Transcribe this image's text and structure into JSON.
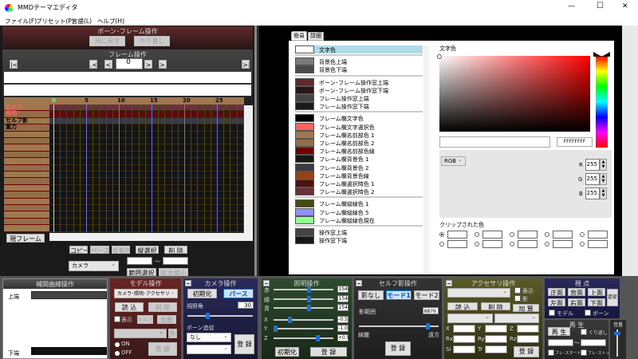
{
  "window": {
    "title": "MMDテーマエディタ",
    "min": "—",
    "max": "☐",
    "close": "✕"
  },
  "menu": [
    "ファイル(F)",
    "プリセット(P)",
    "言語(L)",
    "ヘルプ(H)"
  ],
  "bone_panel": {
    "title": "ボーン･フレーム操作",
    "undo": "元に戻す",
    "redo": "やり直し"
  },
  "frame_panel": {
    "title": "フレーム操作",
    "first": "|<",
    "prev_key": ".<",
    "prev": "<",
    "frame": "0",
    "next": ">",
    "next_key": ">.",
    "last": ">|"
  },
  "timeline": {
    "ticks": [
      "0",
      "5",
      "10",
      "15",
      "20",
      "25"
    ],
    "rows": [
      "カメラ",
      "照明",
      "セルフ影",
      "重力",
      "",
      "",
      "",
      "",
      "",
      "",
      "",
      "",
      "",
      "",
      "",
      "",
      "",
      "",
      ""
    ],
    "current_frame_btn": "現フレーム"
  },
  "edit": {
    "copy": "コピー",
    "paste": "ペースト",
    "flip": "反転P",
    "vsel": "縦選択",
    "del": "削 除",
    "target": "カメラ",
    "tilde": "〜",
    "range": "範囲選択",
    "scale": "拡大縮小"
  },
  "tabs": [
    "簡易",
    "詳細"
  ],
  "color_groups": [
    [
      {
        "label": "文字色",
        "color": "#ffffff"
      }
    ],
    [
      {
        "label": "背景色上端",
        "color": "#7a7a7a"
      },
      {
        "label": "背景色下端",
        "color": "#4a4a4a"
      }
    ],
    [
      {
        "label": "ボーン･フレーム操作窓上端",
        "color": "#5e2a2a"
      },
      {
        "label": "ボーン･フレーム操作窓下端",
        "color": "#2a1616"
      },
      {
        "label": "フレーム操作窓上端",
        "color": "#444444"
      },
      {
        "label": "フレーム操作窓下端",
        "color": "#1a1a1a"
      }
    ],
    [
      {
        "label": "フレーム欄文字色",
        "color": "#000000"
      },
      {
        "label": "フレーム欄文字選択色",
        "color": "#ff6060"
      },
      {
        "label": "フレーム欄名前部色 1",
        "color": "#a07850"
      },
      {
        "label": "フレーム欄名前部色 2",
        "color": "#946c48"
      },
      {
        "label": "フレーム欄名前部色線",
        "color": "#700000"
      },
      {
        "label": "フレーム欄背景色 1",
        "color": "#181818"
      },
      {
        "label": "フレーム欄背景色 2",
        "color": "#3a3a40"
      },
      {
        "label": "フレーム欄背景色線",
        "color": "#a04010"
      },
      {
        "label": "フレーム欄選択時色 1",
        "color": "#501010"
      },
      {
        "label": "フレーム欄選択時色 2",
        "color": "#6a3038"
      }
    ],
    [
      {
        "label": "フレーム欄縦線色 1",
        "color": "#4a4a10"
      },
      {
        "label": "フレーム欄縦線色 5",
        "color": "#9090ff"
      },
      {
        "label": "フレーム欄縦線色現在",
        "color": "#90ff90"
      }
    ],
    [
      {
        "label": "操作窓上端",
        "color": "#444444"
      },
      {
        "label": "操作窓下端",
        "color": "#181818"
      }
    ]
  ],
  "picker": {
    "title": "文字色",
    "hex": "FFFFFFFF",
    "mode": "RGB",
    "r_label": "R",
    "g_label": "G",
    "b_label": "B",
    "r": "255",
    "g": "255",
    "b": "255",
    "clip_title": "クリップされた色"
  },
  "interp": {
    "title": "補間曲線操作",
    "top": "上端",
    "bottom": "下端"
  },
  "model": {
    "title": "モデル操作",
    "select": "カメラ･照明･アクセサリ",
    "load": "読 込",
    "del": "削 除",
    "show": "表示",
    "self_shadow": "セルフ影",
    "add": "加算",
    "out": "外",
    "on": "ON",
    "off": "OFF",
    "register": "登 録"
  },
  "camera": {
    "title": "カメラ操作",
    "init": "初期化",
    "perspective": "パース",
    "fov_label": "視野角",
    "fov": "30",
    "follow_label": "ボーン追従",
    "follow": "なし",
    "register": "登 録",
    "fov_fraction": 0.3
  },
  "light": {
    "title": "照明操作",
    "labels": [
      "赤",
      "緑",
      "青",
      "X",
      "Y",
      "Z"
    ],
    "values": [
      "154",
      "154",
      "154",
      "-0.5",
      "-1.0",
      "+0.5"
    ],
    "fractions": [
      0.6,
      0.6,
      0.6,
      0.25,
      0.0,
      0.75
    ],
    "init": "初期化",
    "register": "登 録"
  },
  "shadow": {
    "title": "セルフ影操作",
    "none": "影なし",
    "mode1": "モード1",
    "mode2": "モード2",
    "range_label": "影範囲",
    "range": "8876",
    "near": "綺麗",
    "far": "遠方",
    "register": "登 録",
    "fraction": 0.88
  },
  "accessory": {
    "title": "アクセサリ操作",
    "show": "表示",
    "shadow": "影",
    "load": "読 込",
    "del": "削 除",
    "add": "加 算",
    "fields": [
      "X",
      "Y",
      "Z",
      "Rx",
      "Ry",
      "Rz",
      "Si",
      "Tr"
    ],
    "register": "登 録"
  },
  "view": {
    "title": "視 点",
    "front": "正面",
    "back": "背面",
    "top": "上面",
    "left": "左面",
    "right": "右面",
    "bottom": "下面",
    "follow": "追従",
    "model": "モデル",
    "bone": "ボーン"
  },
  "play": {
    "title": "再 生",
    "play": "再 生",
    "repeat": "くり返し",
    "tilde": "〜",
    "start": "フレ･スタート",
    "stop": "フレ･ストップ"
  },
  "volume": {
    "title": "音量",
    "level": 0.9
  }
}
